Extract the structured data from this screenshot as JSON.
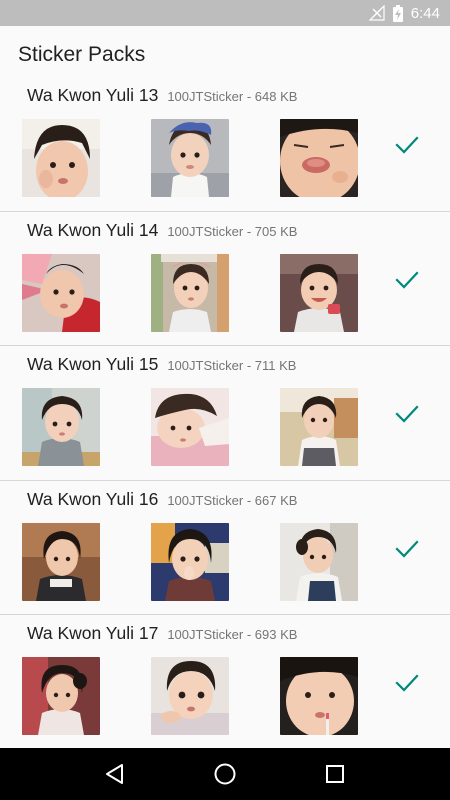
{
  "status_bar": {
    "time": "6:44",
    "icons": [
      "no-signal-icon",
      "battery-charging-icon"
    ]
  },
  "toolbar": {
    "title": "Sticker Packs"
  },
  "colors": {
    "accent": "#00897b",
    "status_bar": "#bdbdbd",
    "background": "#fafafa",
    "divider": "#d6d6d6"
  },
  "packs": [
    {
      "name": "Wa Kwon Yuli 13",
      "publisher": "100JTSticker",
      "separator": "-",
      "size": "648 KB",
      "added": true
    },
    {
      "name": "Wa Kwon Yuli 14",
      "publisher": "100JTSticker",
      "separator": "-",
      "size": "705 KB",
      "added": true
    },
    {
      "name": "Wa Kwon Yuli 15",
      "publisher": "100JTSticker",
      "separator": "-",
      "size": "711 KB",
      "added": true
    },
    {
      "name": "Wa Kwon Yuli 16",
      "publisher": "100JTSticker",
      "separator": "-",
      "size": "667 KB",
      "added": true
    },
    {
      "name": "Wa Kwon Yuli 17",
      "publisher": "100JTSticker",
      "separator": "-",
      "size": "693 KB",
      "added": true
    }
  ],
  "nav": {
    "icons": [
      "back-icon",
      "home-icon",
      "recents-icon"
    ]
  }
}
